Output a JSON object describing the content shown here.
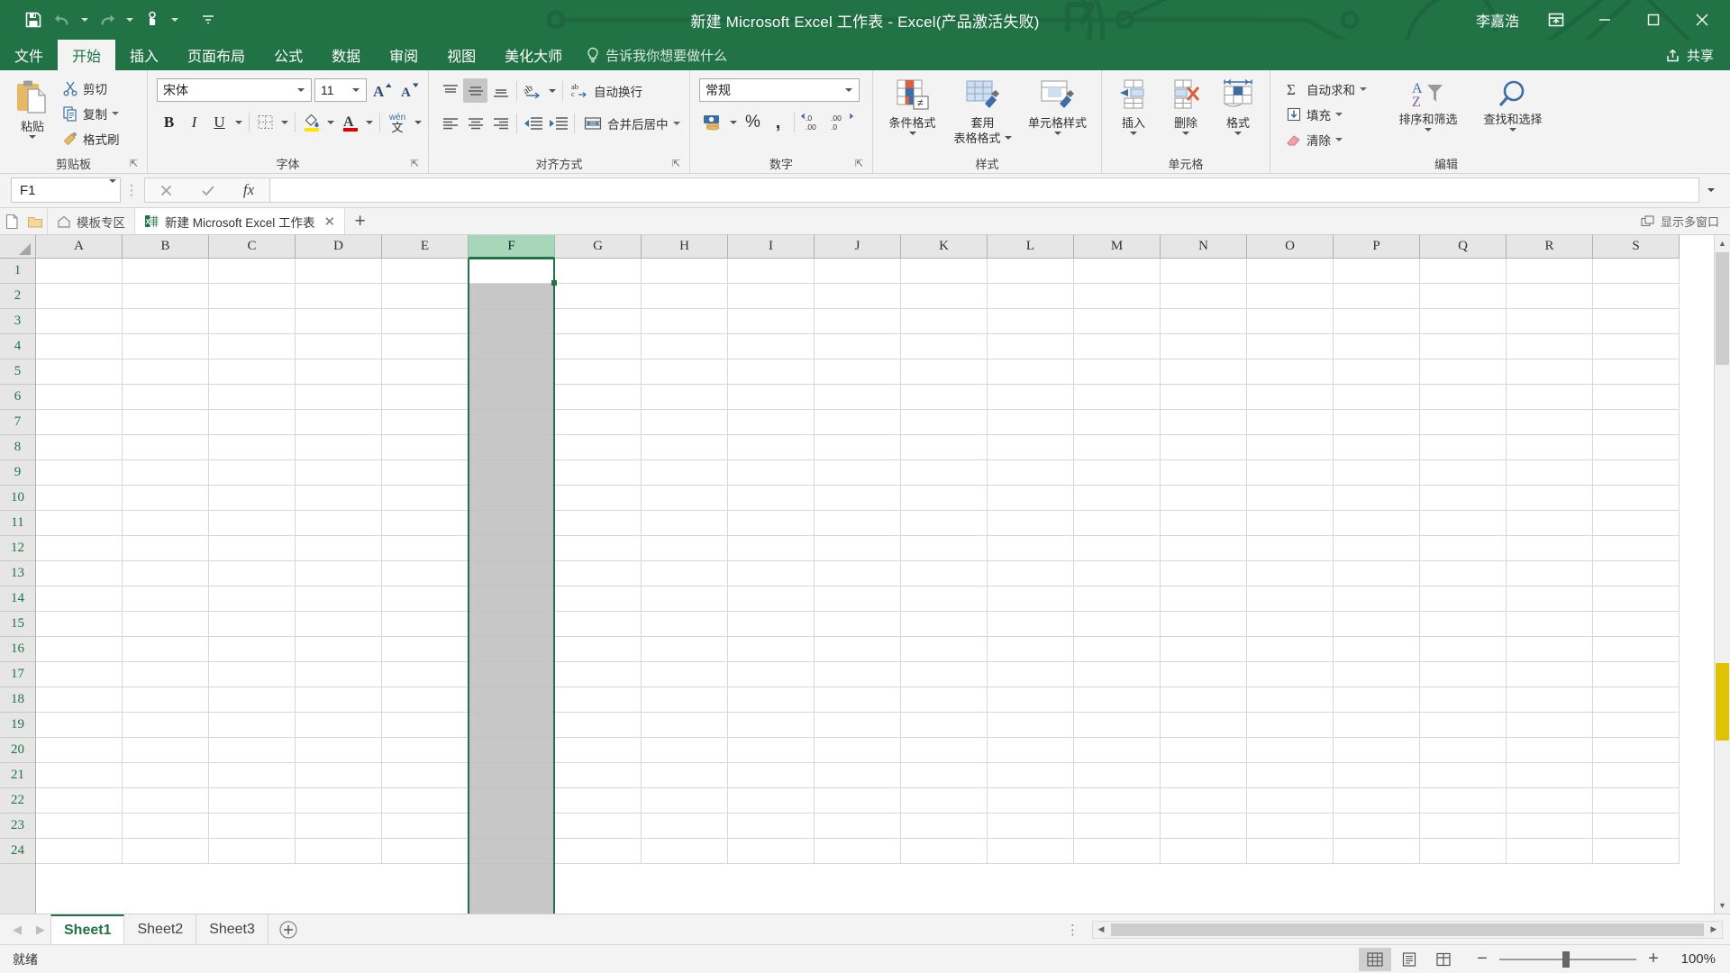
{
  "window": {
    "title": "新建 Microsoft Excel 工作表  -  Excel(产品激活失败)",
    "user": "李嘉浩",
    "restore_icon": "restore-down-icon",
    "minimize_icon": "minimize-icon",
    "maximize_icon": "maximize-icon",
    "close_icon": "close-icon",
    "ribbon_display_icon": "ribbon-display-options-icon",
    "accent": "#217346"
  },
  "qat": {
    "save": "save-icon",
    "undo": "undo-icon",
    "redo": "redo-icon",
    "touch": "touch-mode-icon",
    "customize": "customize-qat-icon"
  },
  "tabs": {
    "items": [
      {
        "label": "文件",
        "active": false,
        "file": true
      },
      {
        "label": "开始",
        "active": true,
        "file": false
      },
      {
        "label": "插入",
        "active": false,
        "file": false
      },
      {
        "label": "页面布局",
        "active": false,
        "file": false
      },
      {
        "label": "公式",
        "active": false,
        "file": false
      },
      {
        "label": "数据",
        "active": false,
        "file": false
      },
      {
        "label": "审阅",
        "active": false,
        "file": false
      },
      {
        "label": "视图",
        "active": false,
        "file": false
      },
      {
        "label": "美化大师",
        "active": false,
        "file": false
      }
    ],
    "tellme": "告诉我你想要做什么",
    "tellme_icon": "lightbulb-icon",
    "share": "共享",
    "share_icon": "share-icon"
  },
  "ribbon": {
    "clipboard": {
      "label": "剪贴板",
      "paste": "粘贴",
      "cut": "剪切",
      "copy": "复制",
      "format_painter": "格式刷"
    },
    "font": {
      "label": "字体",
      "font_name": "宋体",
      "font_size": "11",
      "grow": "A",
      "shrink": "A",
      "bold": "B",
      "italic": "I",
      "underline": "U",
      "borders_icon": "borders-icon",
      "fill_color_icon": "fill-color-icon",
      "font_color_icon": "font-color-icon",
      "phonetic_icon": "phonetic-guide-icon",
      "phonetic_top": "wén",
      "phonetic_bottom": "文"
    },
    "alignment": {
      "label": "对齐方式",
      "top_align": "top-align-icon",
      "middle_align": "middle-align-icon",
      "bottom_align": "bottom-align-icon",
      "orientation": "orientation-icon",
      "align_left": "align-left-icon",
      "align_center": "align-center-icon",
      "align_right": "align-right-icon",
      "decrease_indent": "decrease-indent-icon",
      "increase_indent": "increase-indent-icon",
      "wrap_text": "自动换行",
      "merge_center": "合并后居中"
    },
    "number": {
      "label": "数字",
      "format": "常规",
      "accounting_icon": "accounting-format-icon",
      "percent": "%",
      "comma": ",",
      "increase_decimal": "increase-decimal-icon",
      "decrease_decimal": "decrease-decimal-icon",
      "dec_top": ".00",
      "dec_bottom": ".0"
    },
    "styles": {
      "label": "样式",
      "conditional": "条件格式",
      "table_format_l1": "套用",
      "table_format_l2": "表格格式",
      "cell_styles": "单元格样式"
    },
    "cells": {
      "label": "单元格",
      "insert": "插入",
      "delete": "删除",
      "format": "格式"
    },
    "editing": {
      "label": "编辑",
      "autosum": "自动求和",
      "fill": "填充",
      "clear": "清除",
      "sort_filter": "排序和筛选",
      "find_select": "查找和选择"
    }
  },
  "formula_bar": {
    "name_box": "F1",
    "cancel_icon": "cancel-icon",
    "enter_icon": "confirm-icon",
    "fx_icon": "insert-function-icon",
    "formula_value": "",
    "expand_icon": "expand-formula-bar-icon"
  },
  "doc_tabs": {
    "new_doc_icon": "new-document-icon",
    "open_folder_icon": "open-folder-icon",
    "template_icon": "home-icon",
    "template_label": "模板专区",
    "active_doc_icon": "excel-file-icon",
    "active_doc_label": "新建 Microsoft Excel 工作表",
    "close_icon": "close-tab-icon",
    "add_icon": "new-tab-icon",
    "multi_window_icon": "multi-window-icon",
    "multi_window_label": "显示多窗口"
  },
  "grid": {
    "columns": [
      "A",
      "B",
      "C",
      "D",
      "E",
      "F",
      "G",
      "H",
      "I",
      "J",
      "K",
      "L",
      "M",
      "N",
      "O",
      "P",
      "Q",
      "R",
      "S"
    ],
    "rows": [
      "1",
      "2",
      "3",
      "4",
      "5",
      "6",
      "7",
      "8",
      "9",
      "10",
      "11",
      "12",
      "13",
      "14",
      "15",
      "16",
      "17",
      "18",
      "19",
      "20",
      "21",
      "22",
      "23",
      "24"
    ],
    "selected_column": "F",
    "active_cell": "F1",
    "select_all_icon": "select-all-icon"
  },
  "sheets": {
    "prev_icon": "previous-sheet-icon",
    "next_icon": "next-sheet-icon",
    "items": [
      {
        "label": "Sheet1",
        "active": true
      },
      {
        "label": "Sheet2",
        "active": false
      },
      {
        "label": "Sheet3",
        "active": false
      }
    ],
    "add_icon": "add-sheet-icon"
  },
  "status": {
    "text": "就绪",
    "view_normal_icon": "normal-view-icon",
    "view_layout_icon": "page-layout-view-icon",
    "view_break_icon": "page-break-view-icon",
    "zoom_out": "−",
    "zoom_in": "+",
    "zoom_level": "100%"
  }
}
